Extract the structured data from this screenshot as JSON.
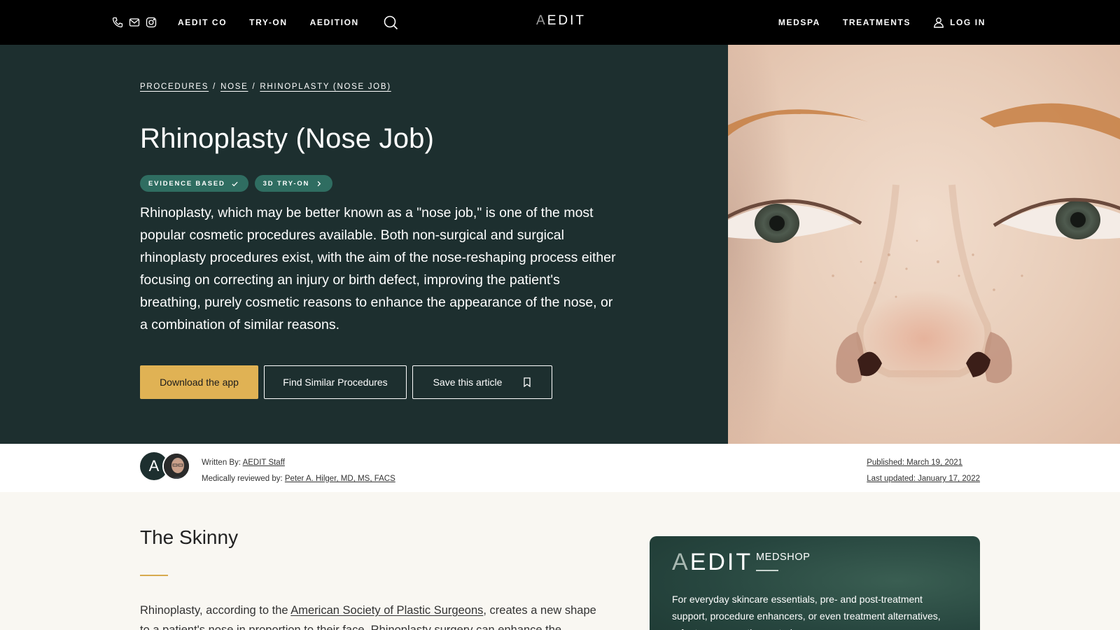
{
  "nav": {
    "left_links": [
      "AEDIT CO",
      "TRY-ON",
      "AEDITION"
    ],
    "logo_first": "A",
    "logo_rest": "EDIT",
    "right_links": [
      "MEDSPA",
      "TREATMENTS"
    ],
    "login_label": "LOG IN",
    "icons": [
      "phone-icon",
      "mail-icon",
      "instagram-icon",
      "search-icon",
      "user-icon"
    ]
  },
  "hero": {
    "breadcrumb": [
      "PROCEDURES",
      "NOSE",
      "RHINOPLASTY (NOSE JOB)"
    ],
    "breadcrumb_separator": "/",
    "title": "Rhinoplasty (Nose Job)",
    "badges": [
      "EVIDENCE BASED",
      "3D TRY-ON"
    ],
    "intro": "Rhinoplasty, which may be better known as a \"nose job,\" is one of the most popular cosmetic procedures available. Both non-surgical and surgical rhinoplasty procedures exist, with the aim of the nose-reshaping process either focusing on correcting an injury or birth defect, improving the patient's breathing, purely cosmetic reasons to enhance the appearance of the nose, or a combination of similar reasons.",
    "buttons": {
      "download": "Download the app",
      "similar": "Find Similar Procedures",
      "save": "Save this article"
    },
    "colors": {
      "background": "#1d2f2f",
      "badge": "#2f6d61",
      "cta": "#e0b254"
    }
  },
  "author": {
    "avatar_letter": "A",
    "written_by_label": "Written By:",
    "written_by": "AEDIT Staff",
    "reviewed_by_label": "Medically reviewed by:",
    "reviewed_by": "Peter A. Hilger, MD, MS, FACS",
    "published": "Published: March 19, 2021",
    "updated": "Last updated: January 17, 2022"
  },
  "content": {
    "section_title": "The Skinny",
    "para_before_link": "Rhinoplasty, according to the ",
    "para_link": "American Society of Plastic Surgeons",
    "para_after_link": ", creates a new shape to a patient's nose in proportion to their face. Rhinoplasty surgery can enhance the appearance of"
  },
  "medshop": {
    "logo_first": "A",
    "logo_rest": "EDIT",
    "tag": "MEDSHOP",
    "text": "For everyday skincare essentials, pre- and post-treatment support, procedure enhancers, or even treatment alternatives, refer to our expertly curated"
  }
}
